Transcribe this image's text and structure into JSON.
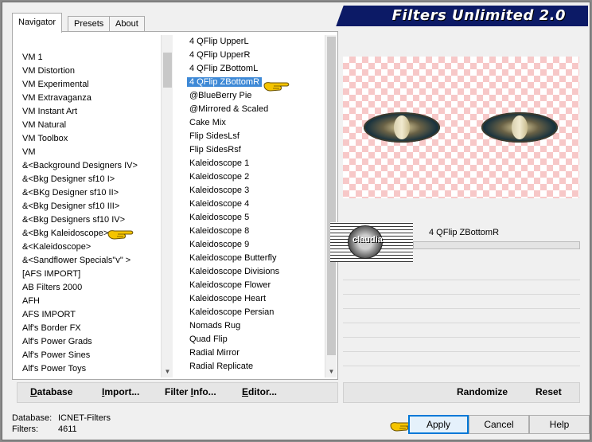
{
  "window": {
    "title": "Filters Unlimited 2.0"
  },
  "tabs": [
    {
      "label": "Navigator",
      "active": true
    },
    {
      "label": "Presets",
      "active": false
    },
    {
      "label": "About",
      "active": false
    }
  ],
  "categories": [
    {
      "label": "VM 1"
    },
    {
      "label": "VM Distortion"
    },
    {
      "label": "VM Experimental"
    },
    {
      "label": "VM Extravaganza"
    },
    {
      "label": "VM Instant Art"
    },
    {
      "label": "VM Natural"
    },
    {
      "label": "VM Toolbox"
    },
    {
      "label": "VM"
    },
    {
      "label": "&<Background Designers IV>"
    },
    {
      "label": "&<Bkg Designer sf10 I>"
    },
    {
      "label": "&<BKg Designer sf10 II>"
    },
    {
      "label": "&<Bkg Designer sf10 III>"
    },
    {
      "label": "&<Bkg Designers sf10 IV>"
    },
    {
      "label": "&<Bkg Kaleidoscope>"
    },
    {
      "label": "&<Kaleidoscope>"
    },
    {
      "label": "&<Sandflower Specials\"v\" >"
    },
    {
      "label": "[AFS IMPORT]"
    },
    {
      "label": "AB Filters 2000"
    },
    {
      "label": "AFH"
    },
    {
      "label": "AFS IMPORT"
    },
    {
      "label": "Alf's Border FX"
    },
    {
      "label": "Alf's Power Grads"
    },
    {
      "label": "Alf's Power Sines"
    },
    {
      "label": "Alf's Power Toys"
    }
  ],
  "filters": [
    {
      "label": "4 QFlip UpperL"
    },
    {
      "label": "4 QFlip UpperR"
    },
    {
      "label": "4 QFlip ZBottomL"
    },
    {
      "label": "4 QFlip ZBottomR",
      "selected": true
    },
    {
      "label": "@BlueBerry Pie"
    },
    {
      "label": "@Mirrored & Scaled"
    },
    {
      "label": "Cake Mix"
    },
    {
      "label": "Flip SidesLsf"
    },
    {
      "label": "Flip SidesRsf"
    },
    {
      "label": "Kaleidoscope 1"
    },
    {
      "label": "Kaleidoscope 2"
    },
    {
      "label": "Kaleidoscope 3"
    },
    {
      "label": "Kaleidoscope 4"
    },
    {
      "label": "Kaleidoscope 5"
    },
    {
      "label": "Kaleidoscope 8"
    },
    {
      "label": "Kaleidoscope 9"
    },
    {
      "label": "Kaleidoscope Butterfly"
    },
    {
      "label": "Kaleidoscope Divisions"
    },
    {
      "label": "Kaleidoscope Flower"
    },
    {
      "label": "Kaleidoscope Heart"
    },
    {
      "label": "Kaleidoscope Persian"
    },
    {
      "label": "Nomads Rug"
    },
    {
      "label": "Quad Flip"
    },
    {
      "label": "Radial Mirror"
    },
    {
      "label": "Radial Replicate"
    }
  ],
  "preview": {
    "filter_name": "4 QFlip ZBottomR",
    "logo_text": "claudia"
  },
  "toolbar": {
    "database": {
      "ul": "D",
      "rest": "atabase"
    },
    "import": {
      "ul": "I",
      "rest": "mport..."
    },
    "filter_info": {
      "pre": "Filter ",
      "ul": "I",
      "rest": "nfo..."
    },
    "editor": {
      "ul": "E",
      "rest": "ditor..."
    },
    "randomize": "Randomize",
    "reset": "Reset"
  },
  "status": {
    "database_label": "Database:",
    "database_value": "ICNET-Filters",
    "filters_label": "Filters:",
    "filters_value": "4611"
  },
  "buttons": {
    "apply": "Apply",
    "cancel": "Cancel",
    "help": "Help"
  },
  "colors": {
    "selection": "#3e89d6",
    "title_banner": "#0c1a66",
    "checker_pink": "#f7c8c8",
    "pointer_yellow": "#f5c400"
  }
}
